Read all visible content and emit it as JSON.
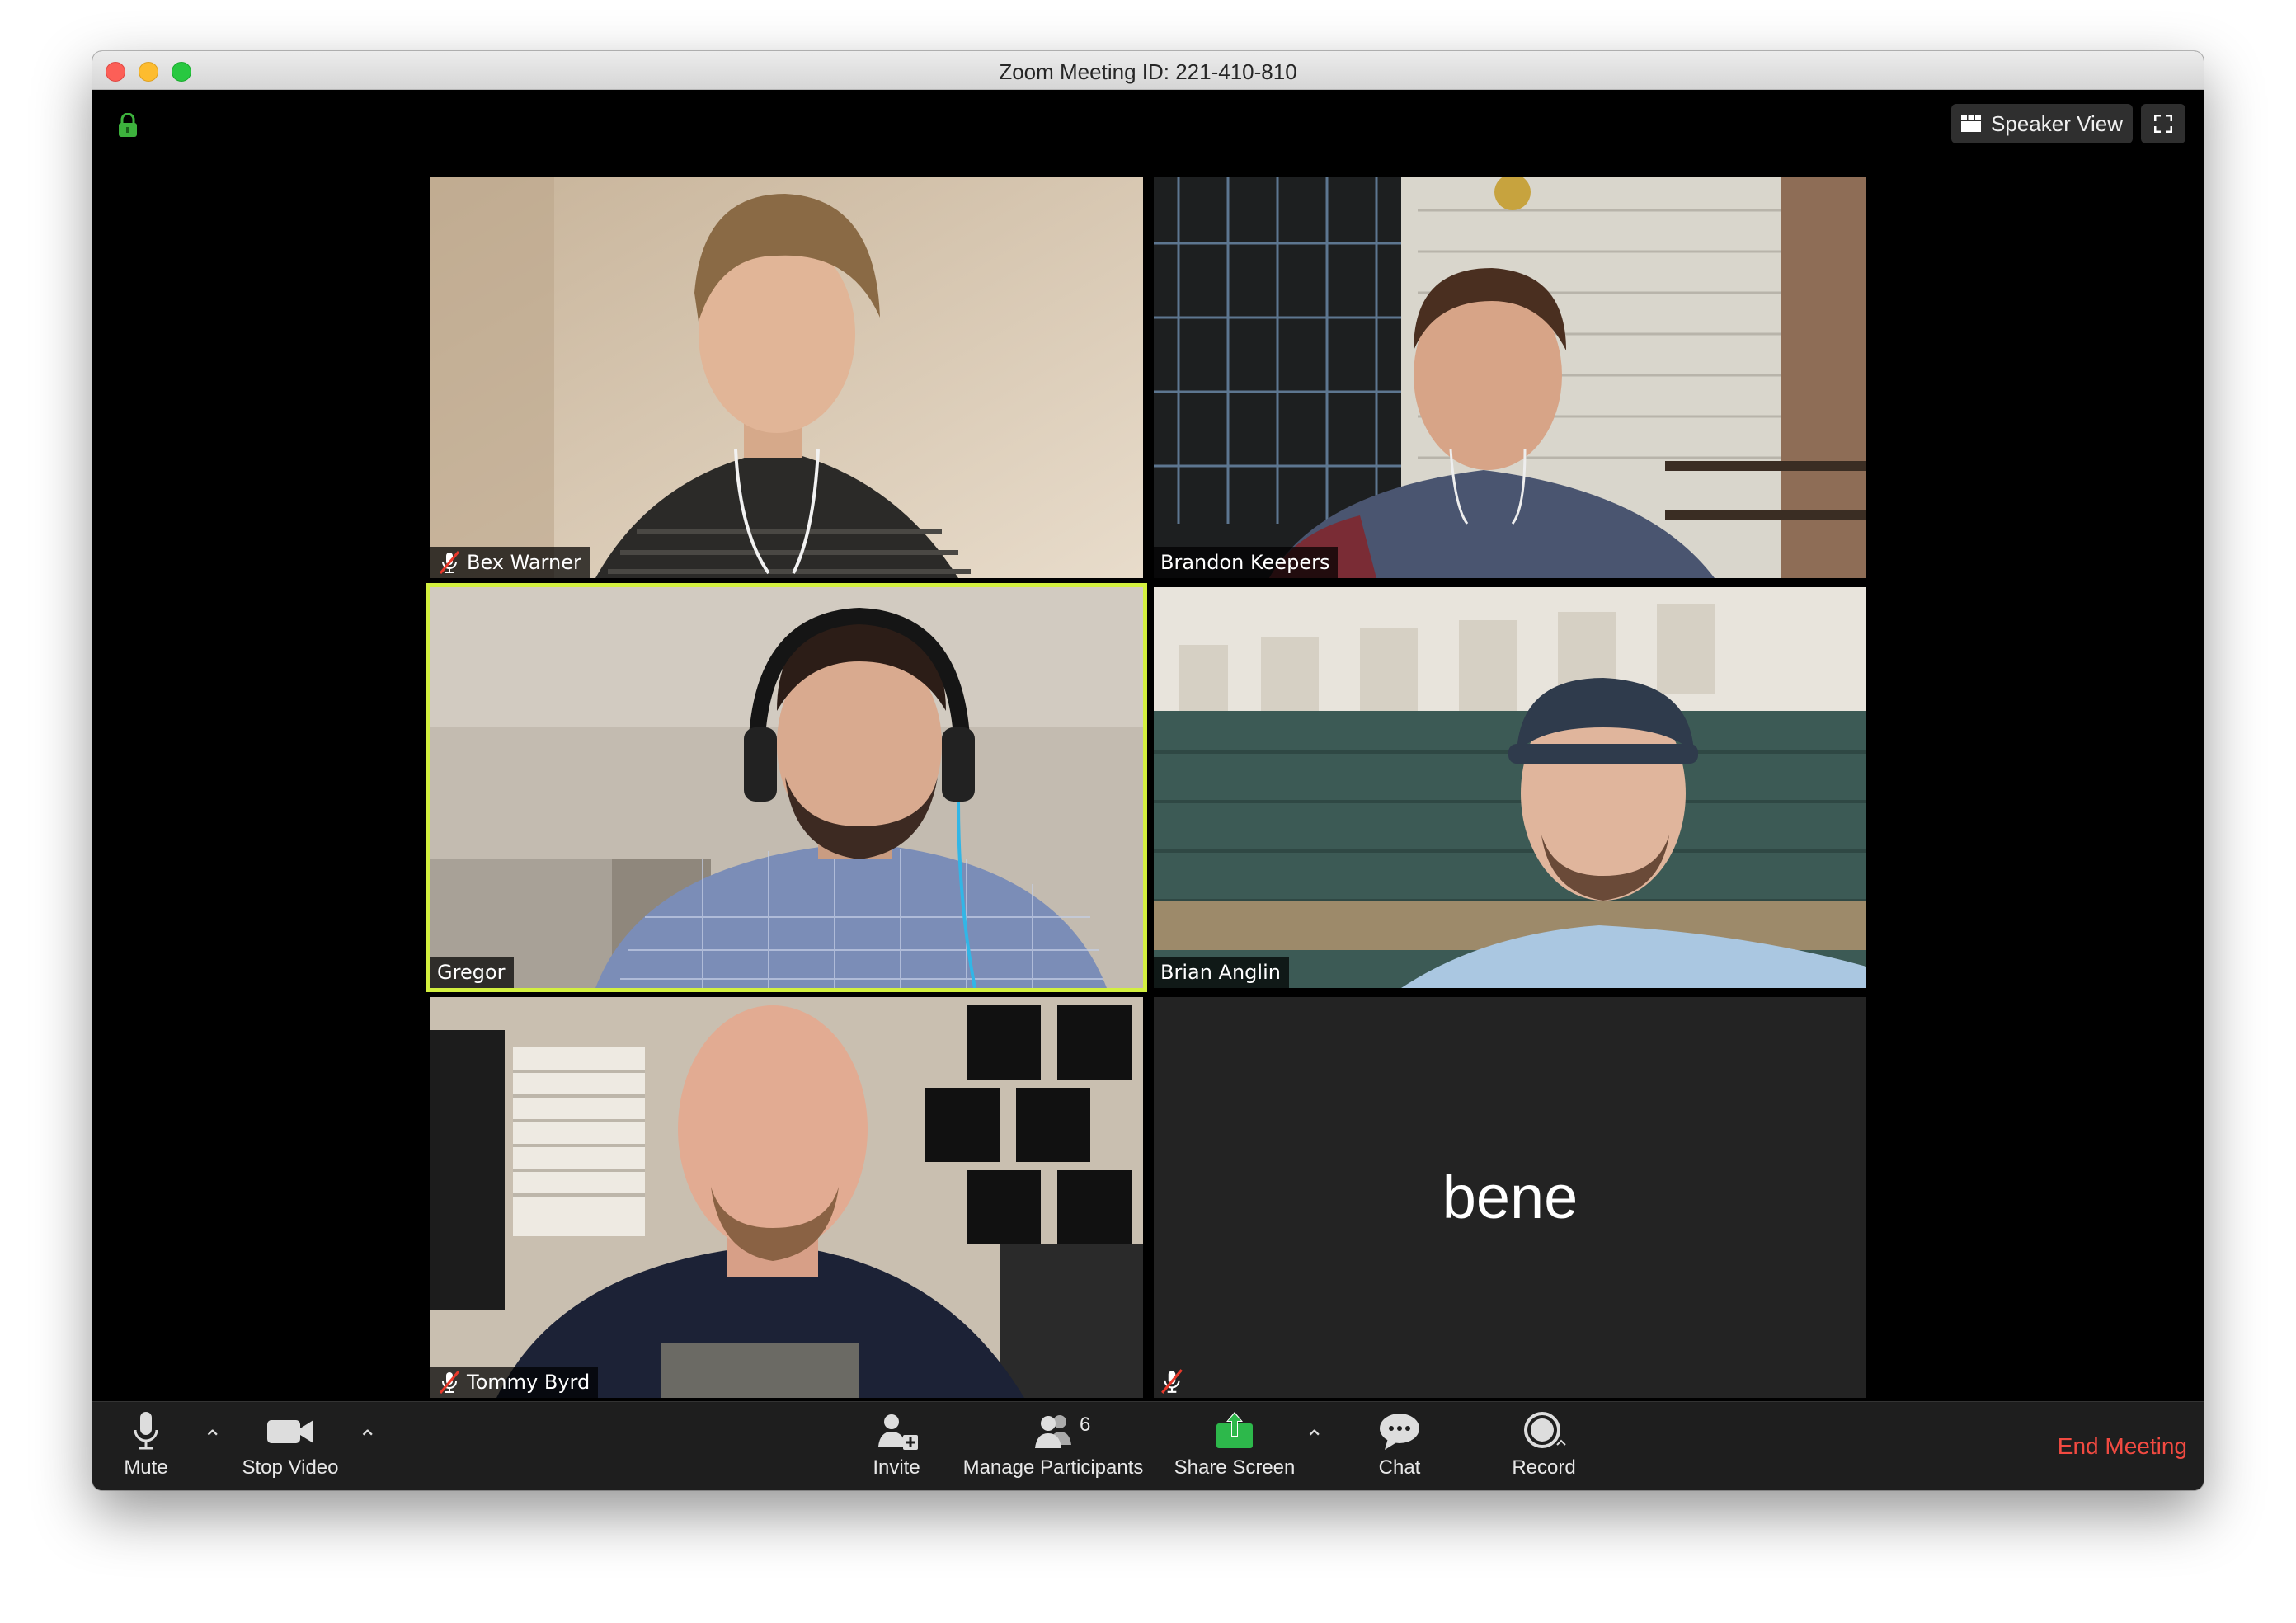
{
  "window": {
    "title": "Zoom Meeting ID: 221-410-810"
  },
  "top_controls": {
    "speaker_view_label": "Speaker View"
  },
  "participants": [
    {
      "name": "Bex Warner",
      "muted": true,
      "video": true,
      "active": false
    },
    {
      "name": "Brandon Keepers",
      "muted": false,
      "video": true,
      "active": false
    },
    {
      "name": "Gregor",
      "muted": false,
      "video": true,
      "active": true
    },
    {
      "name": "Brian Anglin",
      "muted": false,
      "video": true,
      "active": false
    },
    {
      "name": "Tommy Byrd",
      "muted": true,
      "video": true,
      "active": false
    },
    {
      "name": "bene",
      "muted": true,
      "video": false,
      "active": false
    }
  ],
  "toolbar": {
    "mute_label": "Mute",
    "stop_video_label": "Stop Video",
    "invite_label": "Invite",
    "manage_participants_label": "Manage Participants",
    "participant_count": "6",
    "share_screen_label": "Share Screen",
    "chat_label": "Chat",
    "record_label": "Record",
    "end_meeting_label": "End Meeting"
  },
  "colors": {
    "active_speaker_border": "#d3f03f",
    "end_meeting": "#f24a41",
    "share_screen": "#2db84b",
    "lock": "#3db23d"
  }
}
